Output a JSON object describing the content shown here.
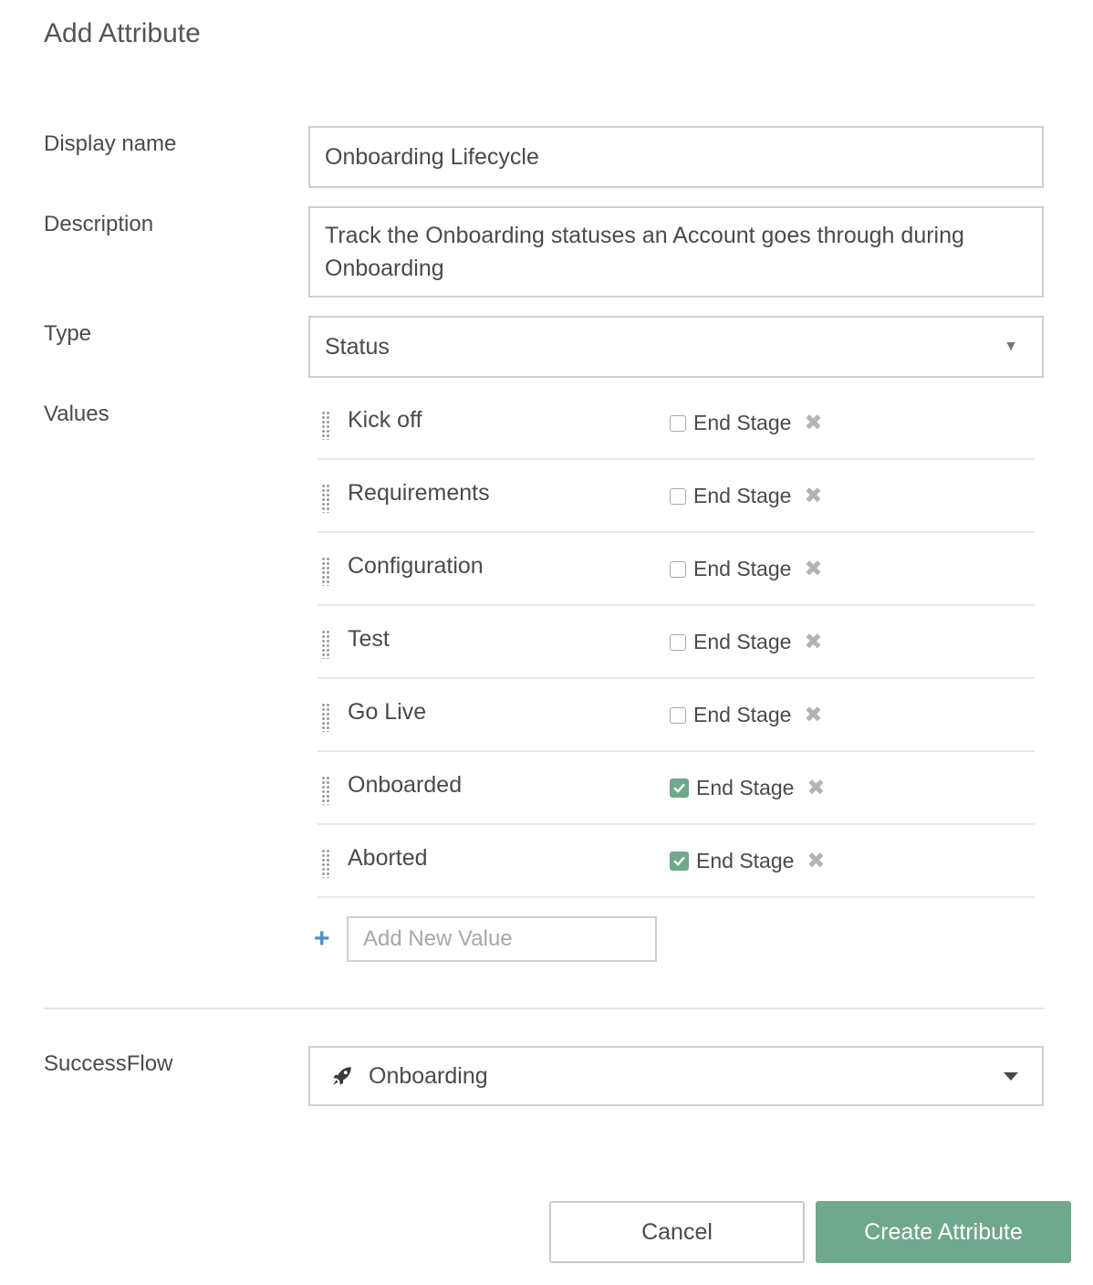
{
  "dialog": {
    "title": "Add Attribute"
  },
  "form": {
    "display_name": {
      "label": "Display name",
      "value": "Onboarding Lifecycle"
    },
    "description": {
      "label": "Description",
      "value": "Track the Onboarding statuses an Account goes through during Onboarding"
    },
    "type": {
      "label": "Type",
      "value": "Status"
    },
    "values": {
      "label": "Values",
      "end_stage_label": "End Stage",
      "items": [
        {
          "name": "Kick off",
          "end_stage": false
        },
        {
          "name": "Requirements",
          "end_stage": false
        },
        {
          "name": "Configuration",
          "end_stage": false
        },
        {
          "name": "Test",
          "end_stage": false
        },
        {
          "name": "Go Live",
          "end_stage": false
        },
        {
          "name": "Onboarded",
          "end_stage": true
        },
        {
          "name": "Aborted",
          "end_stage": true
        }
      ],
      "add_placeholder": "Add New Value"
    },
    "successflow": {
      "label": "SuccessFlow",
      "value": "Onboarding",
      "icon": "rocket-icon"
    }
  },
  "footer": {
    "cancel_label": "Cancel",
    "create_label": "Create Attribute"
  },
  "colors": {
    "accent": "#6fa88c",
    "plus": "#4b8fd0",
    "border": "#cfcfcf"
  }
}
